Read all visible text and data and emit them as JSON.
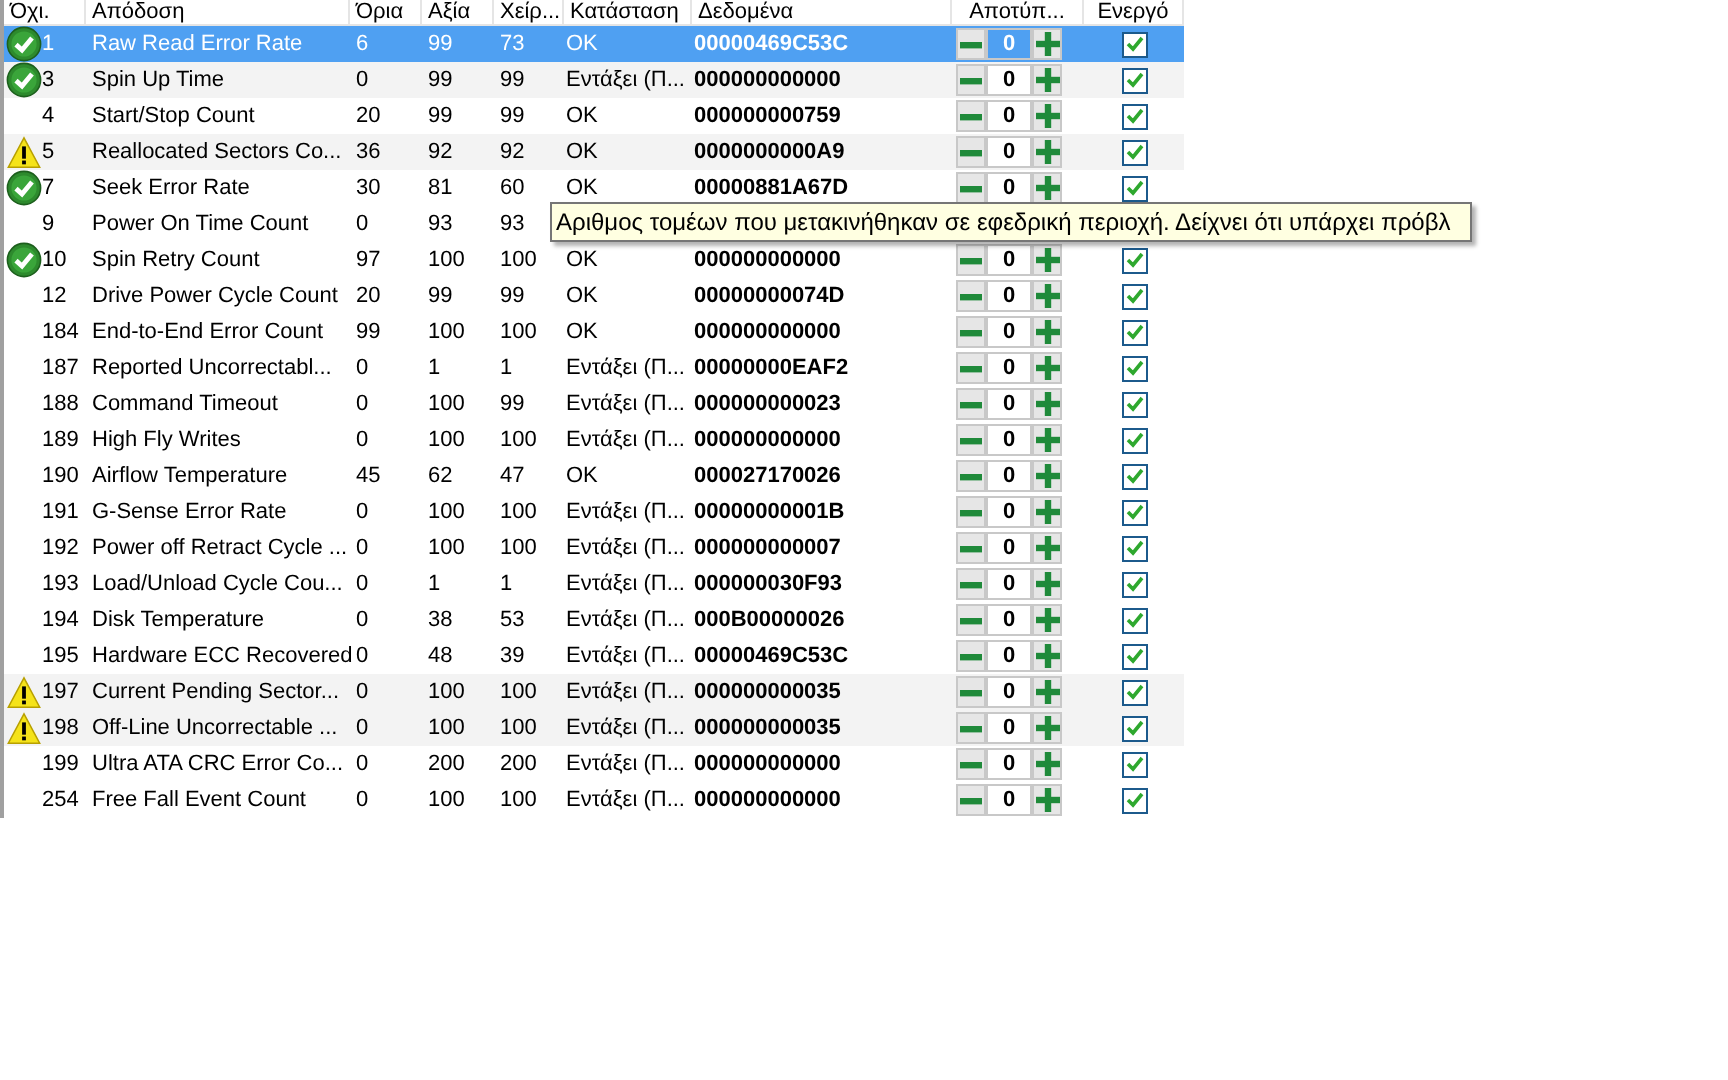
{
  "columns": [
    "Όχι.",
    "Απόδοση",
    "Όρια",
    "Αξία",
    "Χείρ...",
    "Κατάσταση",
    "Δεδομένα",
    "Αποτύπ...",
    "Ενεργό"
  ],
  "rows": [
    {
      "kind": "check",
      "id": "1",
      "name": "Raw Read Error Rate",
      "threshold": "6",
      "value": "99",
      "worst": "73",
      "status": "OK",
      "data": "00000469C53C",
      "failures": "0",
      "enabled": true,
      "selected": true
    },
    {
      "kind": "check",
      "id": "3",
      "name": "Spin Up Time",
      "threshold": "0",
      "value": "99",
      "worst": "99",
      "status": "Εντάξει (Π...",
      "data": "000000000000",
      "failures": "0",
      "enabled": true,
      "selected": false,
      "shaded": true
    },
    {
      "kind": "plain",
      "id": "4",
      "name": "Start/Stop Count",
      "threshold": "20",
      "value": "99",
      "worst": "99",
      "status": "OK",
      "data": "000000000759",
      "failures": "0",
      "enabled": true,
      "selected": false,
      "shaded": false
    },
    {
      "kind": "warning",
      "id": "5",
      "name": "Reallocated Sectors Co...",
      "threshold": "36",
      "value": "92",
      "worst": "92",
      "status": "OK",
      "data": "0000000000A9",
      "failures": "0",
      "enabled": true,
      "selected": false,
      "shaded": true
    },
    {
      "kind": "check",
      "id": "7",
      "name": "Seek Error Rate",
      "threshold": "30",
      "value": "81",
      "worst": "60",
      "status": "OK",
      "data": "00000881A67D",
      "failures": "0",
      "enabled": true,
      "selected": false,
      "shaded": false
    },
    {
      "kind": "plain",
      "id": "9",
      "name": "Power On Time Count",
      "threshold": "0",
      "value": "93",
      "worst": "93",
      "selected": false,
      "shaded": false
    },
    {
      "kind": "check",
      "id": "10",
      "name": "Spin Retry Count",
      "threshold": "97",
      "value": "100",
      "worst": "100",
      "status": "OK",
      "data": "000000000000",
      "failures": "0",
      "enabled": true,
      "selected": false,
      "shaded": false
    },
    {
      "kind": "plain",
      "id": "12",
      "name": "Drive Power Cycle Count",
      "threshold": "20",
      "value": "99",
      "worst": "99",
      "status": "OK",
      "data": "00000000074D",
      "failures": "0",
      "enabled": true,
      "selected": false,
      "shaded": false
    },
    {
      "kind": "plain",
      "id": "184",
      "name": "End-to-End Error Count",
      "threshold": "99",
      "value": "100",
      "worst": "100",
      "status": "OK",
      "data": "000000000000",
      "failures": "0",
      "enabled": true,
      "selected": false,
      "shaded": false
    },
    {
      "kind": "plain",
      "id": "187",
      "name": "Reported Uncorrectabl...",
      "threshold": "0",
      "value": "1",
      "worst": "1",
      "status": "Εντάξει (Π...",
      "data": "00000000EAF2",
      "failures": "0",
      "enabled": true,
      "selected": false,
      "shaded": false
    },
    {
      "kind": "plain",
      "id": "188",
      "name": "Command Timeout",
      "threshold": "0",
      "value": "100",
      "worst": "99",
      "status": "Εντάξει (Π...",
      "data": "000000000023",
      "failures": "0",
      "enabled": true,
      "selected": false,
      "shaded": false
    },
    {
      "kind": "plain",
      "id": "189",
      "name": "High Fly Writes",
      "threshold": "0",
      "value": "100",
      "worst": "100",
      "status": "Εντάξει (Π...",
      "data": "000000000000",
      "failures": "0",
      "enabled": true,
      "selected": false,
      "shaded": false
    },
    {
      "kind": "plain",
      "id": "190",
      "name": "Airflow Temperature",
      "threshold": "45",
      "value": "62",
      "worst": "47",
      "status": "OK",
      "data": "000027170026",
      "failures": "0",
      "enabled": true,
      "selected": false,
      "shaded": false
    },
    {
      "kind": "plain",
      "id": "191",
      "name": "G-Sense Error Rate",
      "threshold": "0",
      "value": "100",
      "worst": "100",
      "status": "Εντάξει (Π...",
      "data": "00000000001B",
      "failures": "0",
      "enabled": true,
      "selected": false,
      "shaded": false
    },
    {
      "kind": "plain",
      "id": "192",
      "name": "Power off Retract Cycle ...",
      "threshold": "0",
      "value": "100",
      "worst": "100",
      "status": "Εντάξει (Π...",
      "data": "000000000007",
      "failures": "0",
      "enabled": true,
      "selected": false,
      "shaded": false
    },
    {
      "kind": "plain",
      "id": "193",
      "name": "Load/Unload Cycle Cou...",
      "threshold": "0",
      "value": "1",
      "worst": "1",
      "status": "Εντάξει (Π...",
      "data": "000000030F93",
      "failures": "0",
      "enabled": true,
      "selected": false,
      "shaded": false
    },
    {
      "kind": "plain",
      "id": "194",
      "name": "Disk Temperature",
      "threshold": "0",
      "value": "38",
      "worst": "53",
      "status": "Εντάξει (Π...",
      "data": "000B00000026",
      "failures": "0",
      "enabled": true,
      "selected": false,
      "shaded": false
    },
    {
      "kind": "plain",
      "id": "195",
      "name": "Hardware ECC Recovered",
      "threshold": "0",
      "value": "48",
      "worst": "39",
      "status": "Εντάξει (Π...",
      "data": "00000469C53C",
      "failures": "0",
      "enabled": true,
      "selected": false,
      "shaded": false
    },
    {
      "kind": "warning",
      "id": "197",
      "name": "Current Pending Sector...",
      "threshold": "0",
      "value": "100",
      "worst": "100",
      "status": "Εντάξει (Π...",
      "data": "000000000035",
      "failures": "0",
      "enabled": true,
      "selected": false,
      "shaded": true
    },
    {
      "kind": "warning",
      "id": "198",
      "name": "Off-Line Uncorrectable ...",
      "threshold": "0",
      "value": "100",
      "worst": "100",
      "status": "Εντάξει (Π...",
      "data": "000000000035",
      "failures": "0",
      "enabled": true,
      "selected": false,
      "shaded": true
    },
    {
      "kind": "plain",
      "id": "199",
      "name": "Ultra ATA CRC Error Co...",
      "threshold": "0",
      "value": "200",
      "worst": "200",
      "status": "Εντάξει (Π...",
      "data": "000000000000",
      "failures": "0",
      "enabled": true,
      "selected": false,
      "shaded": false
    },
    {
      "kind": "plain",
      "id": "254",
      "name": "Free Fall Event Count",
      "threshold": "0",
      "value": "100",
      "worst": "100",
      "status": "Εντάξει (Π...",
      "data": "000000000000",
      "failures": "0",
      "enabled": true,
      "selected": false,
      "shaded": false
    }
  ],
  "tooltip": "Αριθμος τομέων που μετακινήθηκαν σε εφεδρική περιοχή. Δείχνει ότι υπάρχει πρόβλ"
}
